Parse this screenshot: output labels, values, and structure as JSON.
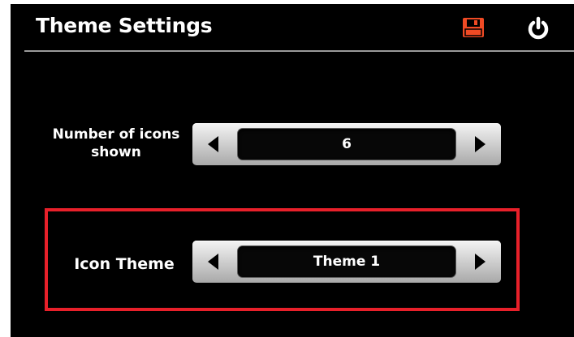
{
  "header": {
    "title": "Theme Settings",
    "save_icon": "save-icon",
    "power_icon": "power-icon",
    "accent_color": "#f04a24"
  },
  "settings": {
    "icon_count": {
      "label": "Number of icons shown",
      "value": "6"
    },
    "icon_theme": {
      "label": "Icon Theme",
      "value": "Theme 1",
      "highlight_color": "#e8202a"
    }
  }
}
